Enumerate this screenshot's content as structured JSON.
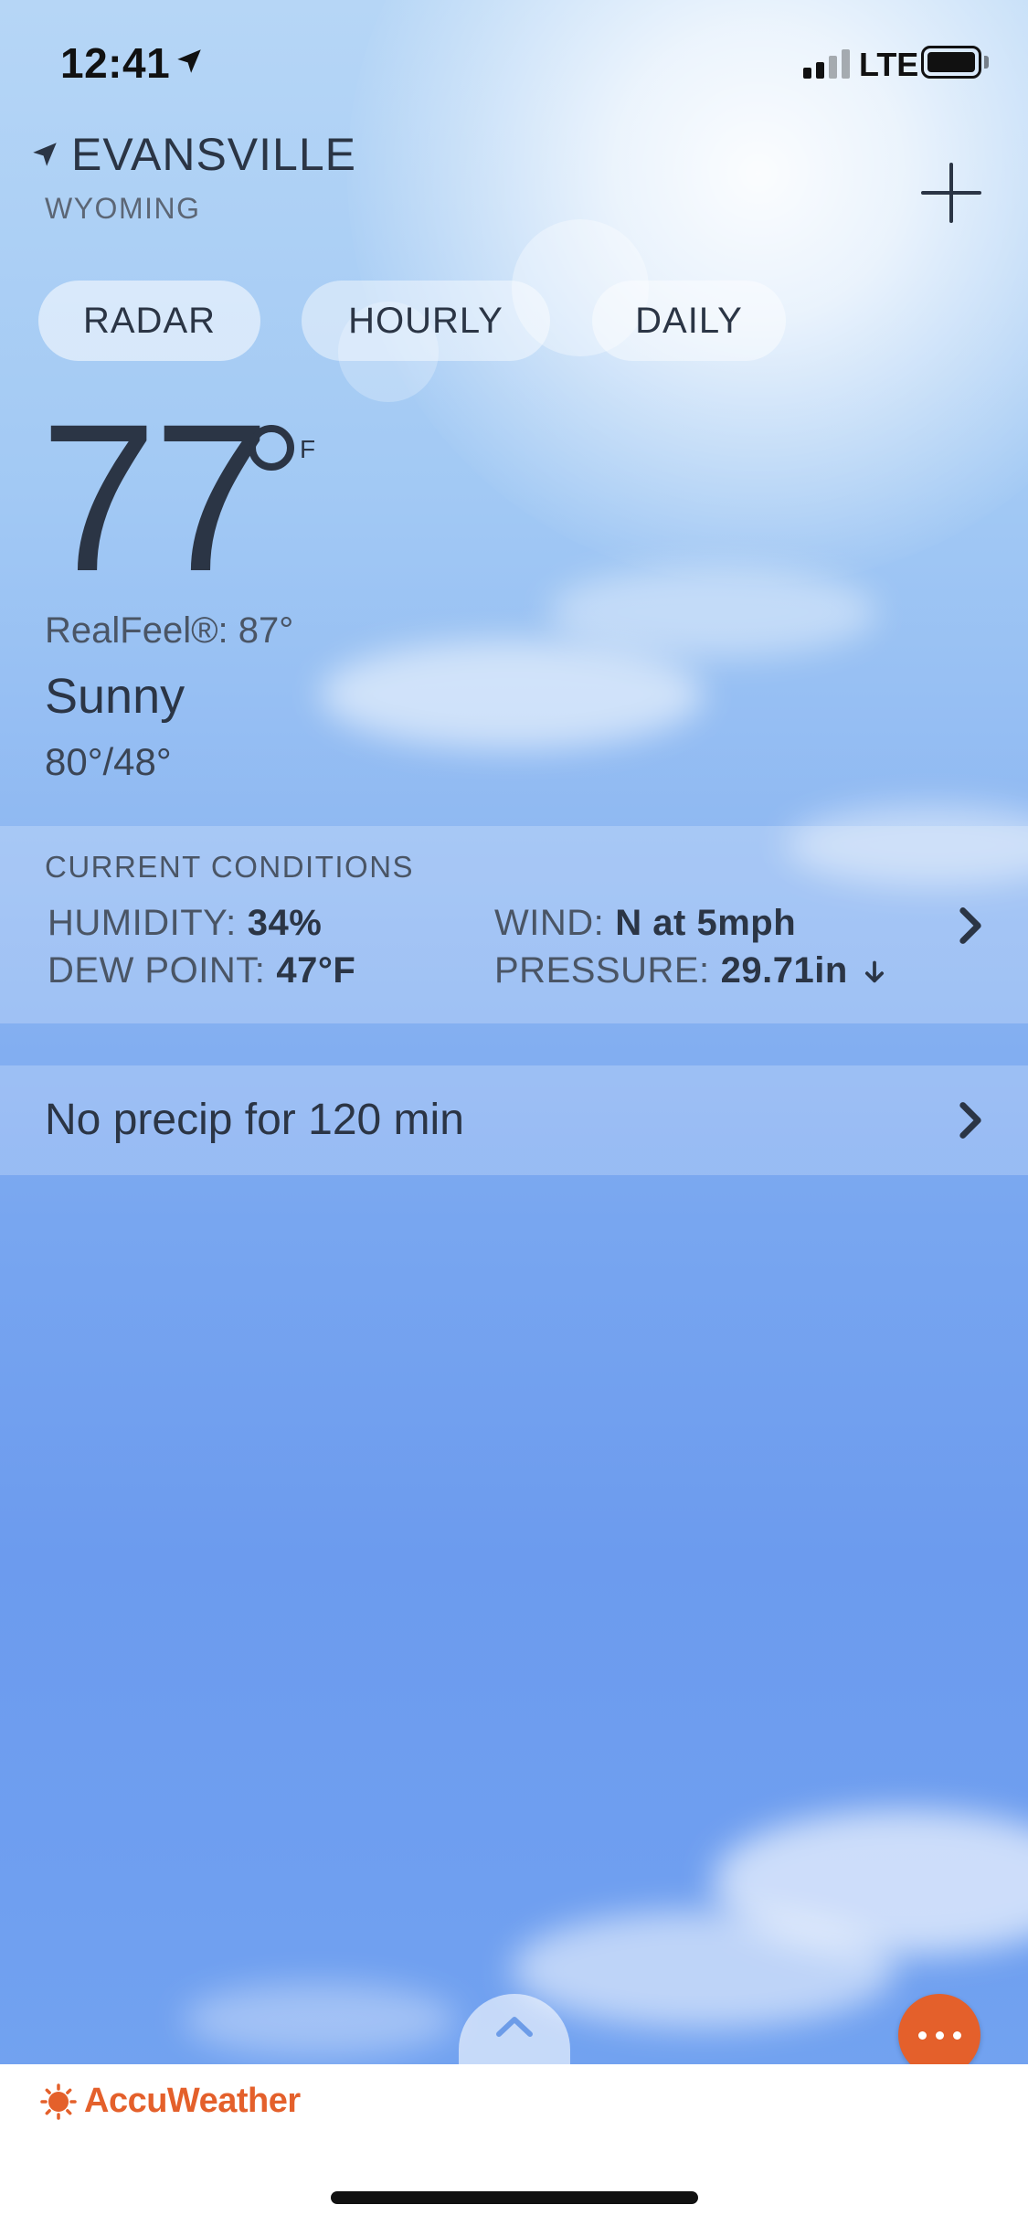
{
  "status_bar": {
    "time": "12:41",
    "network": "LTE"
  },
  "location": {
    "city": "EVANSVILLE",
    "state": "WYOMING"
  },
  "tabs": [
    {
      "label": "RADAR",
      "selected": true
    },
    {
      "label": "HOURLY",
      "selected": false
    },
    {
      "label": "DAILY",
      "selected": false
    }
  ],
  "current": {
    "temperature": "77",
    "unit": "F",
    "realfeel": "RealFeel®: 87°",
    "phrase": "Sunny",
    "hi_lo": "80°/48°"
  },
  "conditions": {
    "title": "CURRENT CONDITIONS",
    "humidity_label": "HUMIDITY:",
    "humidity_value": "34%",
    "dew_label": "DEW POINT:",
    "dew_value": "47°F",
    "wind_label": "WIND:",
    "wind_value": "N at 5mph",
    "pressure_label": "PRESSURE:",
    "pressure_value": "29.71in"
  },
  "precip": {
    "text": "No precip for 120 min"
  },
  "footer": {
    "brand": "AccuWeather"
  },
  "colors": {
    "accent": "#e4602b",
    "text": "#2b3545"
  },
  "icons": [
    "location-arrow-icon",
    "signal-icon",
    "battery-icon",
    "navigation-arrow-icon",
    "plus-icon",
    "chevron-right-icon",
    "arrow-down-icon",
    "chevron-up-icon",
    "more-dots-icon",
    "accuweather-sun-icon"
  ]
}
